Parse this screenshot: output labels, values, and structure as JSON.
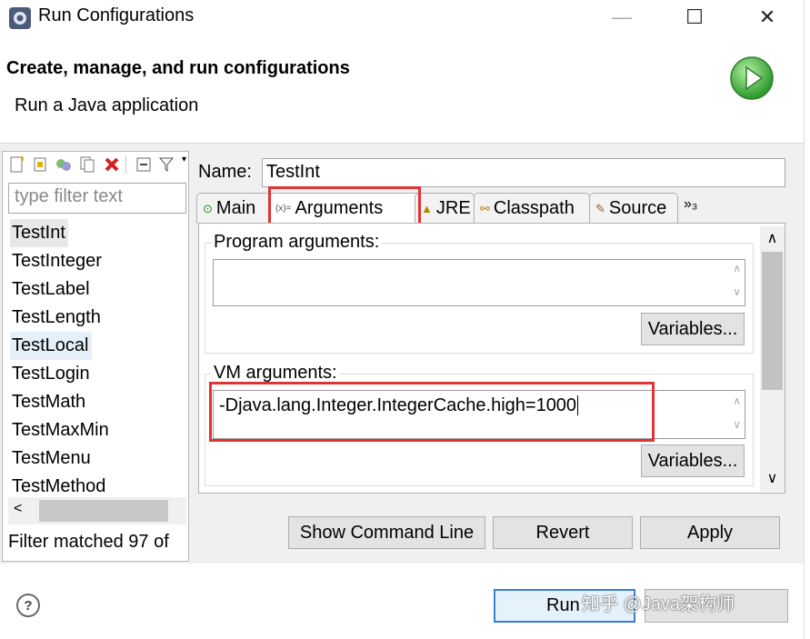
{
  "window": {
    "title": "Run Configurations",
    "minimize_glyph": "—",
    "maximize_glyph": "☐",
    "close_glyph": "✕"
  },
  "header": {
    "title": "Create, manage, and run configurations",
    "subtitle": "Run a Java application",
    "run_icon": "run-play-icon"
  },
  "left": {
    "toolbar_icons": [
      "new-config-icon",
      "new-prototype-icon",
      "export-icon",
      "duplicate-icon",
      "delete-icon",
      "collapse-all-icon",
      "filter-icon",
      "view-menu-icon"
    ],
    "filter_placeholder": "type filter text",
    "items": [
      "TestInt",
      "TestInteger",
      "TestLabel",
      "TestLength",
      "TestLocal",
      "TestLogin",
      "TestMath",
      "TestMaxMin",
      "TestMenu",
      "TestMethod"
    ],
    "selected": "TestInt",
    "scroll_left": "<",
    "status": "Filter matched 97 of"
  },
  "name": {
    "label": "Name:",
    "value": "TestInt"
  },
  "tabs": [
    {
      "label": "Main",
      "icon": "main-tab-icon",
      "glyph": "⊙"
    },
    {
      "label": "Arguments",
      "icon": "arguments-tab-icon",
      "glyph": "(x)="
    },
    {
      "label": "JRE",
      "icon": "jre-tab-icon",
      "glyph": "▲"
    },
    {
      "label": "Classpath",
      "icon": "classpath-tab-icon",
      "glyph": "⚯"
    },
    {
      "label": "Source",
      "icon": "source-tab-icon",
      "glyph": "✎"
    }
  ],
  "tab_overflow": "»₃",
  "arguments": {
    "program_label": "Program arguments:",
    "program_value": "",
    "vm_label": "VM arguments:",
    "vm_value": "-Djava.lang.Integer.IntegerCache.high=1000",
    "variables_label": "Variables..."
  },
  "buttons": {
    "show_command_line": "Show Command Line",
    "revert": "Revert",
    "apply": "Apply",
    "run": "Run"
  },
  "scroll": {
    "up": "∧",
    "down": "∨"
  },
  "help": "?",
  "watermark": "知乎 @Java架构师",
  "colors": {
    "highlight": "#e03434",
    "run_green": "#3aa83a"
  }
}
